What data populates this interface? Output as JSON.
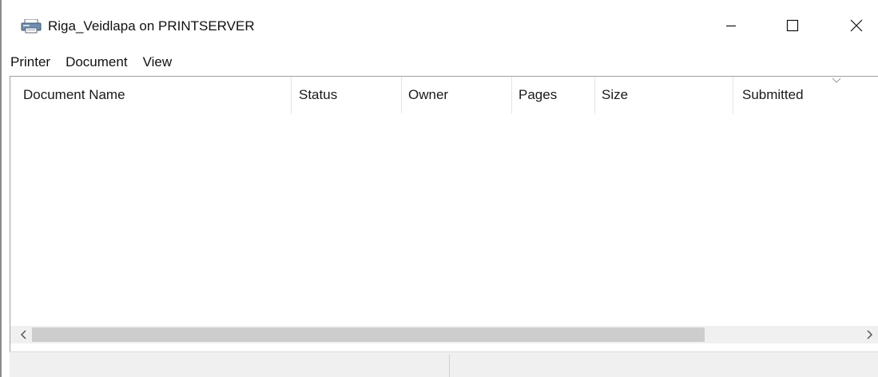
{
  "window": {
    "title": "Riga_Veidlapa on PRINTSERVER",
    "icon": "printer-icon",
    "controls": {
      "minimize": "minimize-icon",
      "maximize": "maximize-icon",
      "close": "close-icon"
    }
  },
  "menu": {
    "items": [
      {
        "label": "Printer"
      },
      {
        "label": "Document"
      },
      {
        "label": "View"
      }
    ]
  },
  "list": {
    "columns": [
      {
        "label": "Document Name"
      },
      {
        "label": "Status"
      },
      {
        "label": "Owner"
      },
      {
        "label": "Pages"
      },
      {
        "label": "Size"
      },
      {
        "label": "Submitted"
      }
    ],
    "sort_indicator": "chevron-down-icon",
    "rows": []
  },
  "scrollbar": {
    "left_arrow": "chevron-left-icon",
    "right_arrow": "chevron-right-icon"
  },
  "statusbar": {
    "pane1": "",
    "pane2": ""
  }
}
